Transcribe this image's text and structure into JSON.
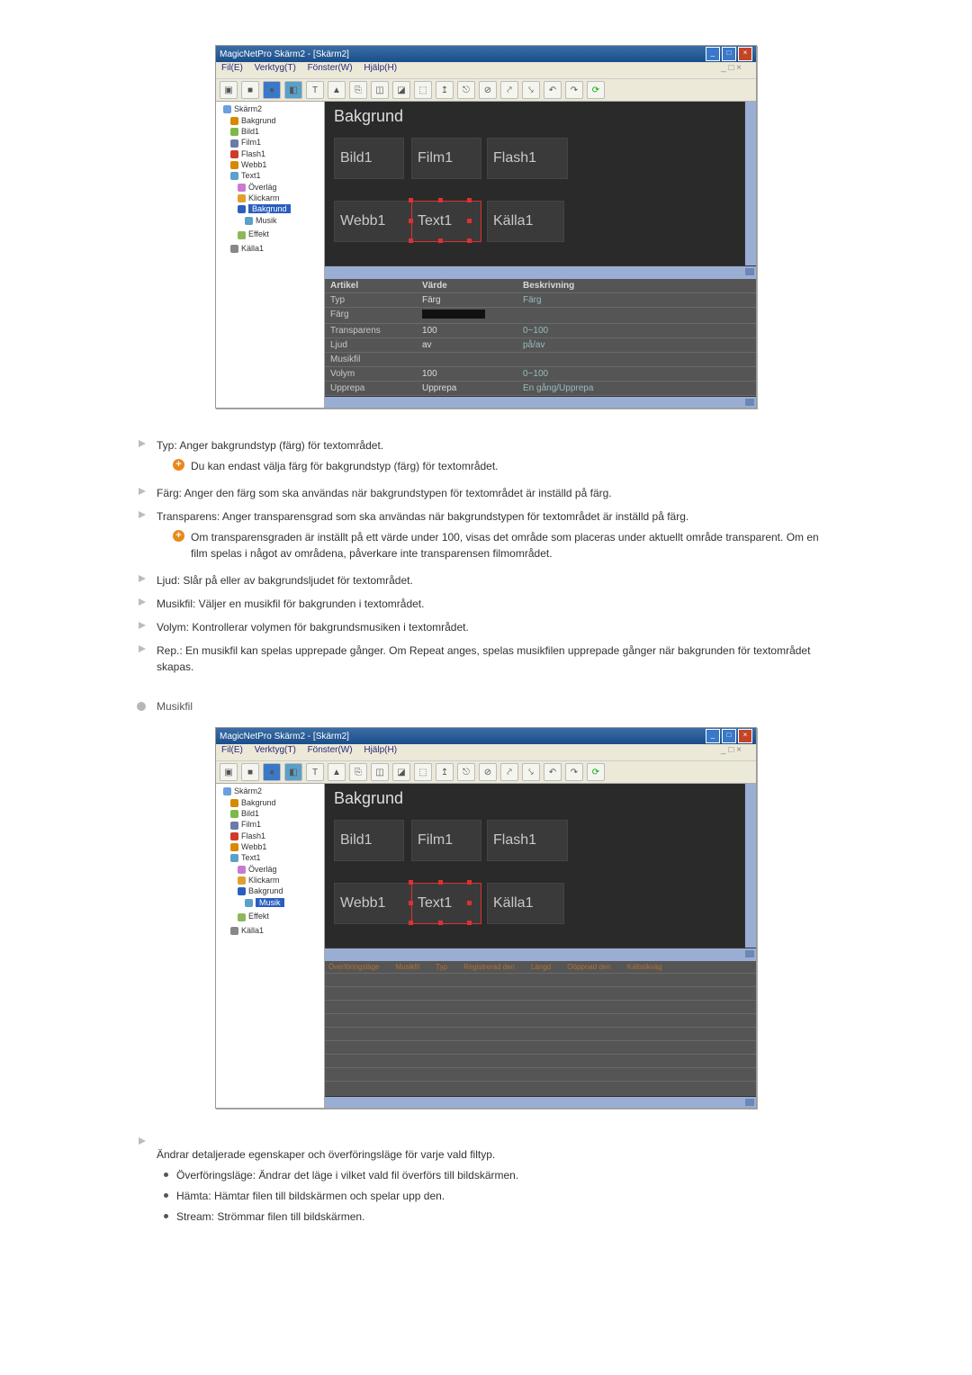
{
  "app": {
    "title": "MagicNetPro Skärm2 - [Skärm2]",
    "menu": [
      "Fil(E)",
      "Verktyg(T)",
      "Fönster(W)",
      "Hjälp(H)"
    ],
    "mdi": "_ □ ×"
  },
  "tree": {
    "root": "Skärm2",
    "items": [
      "Bakgrund",
      "Bild1",
      "Film1",
      "Flash1",
      "Webb1",
      "Text1",
      "Överläg",
      "Klickarm"
    ],
    "sel1": "Bakgrund",
    "sel1b": "Musik",
    "sel2": "Musik",
    "extra": [
      "Effekt",
      "Källa1"
    ]
  },
  "canvas": {
    "title": "Bakgrund",
    "blocks": {
      "b1": "Bild1",
      "b2": "Film1",
      "b3": "Flash1",
      "b4": "Webb1",
      "b5": "Text1",
      "b6": "Källa1"
    }
  },
  "props1": {
    "head": {
      "c1": "Artikel",
      "c2": "Värde",
      "c3": "Beskrivning"
    },
    "rows": [
      {
        "c1": "Typ",
        "c2": "Färg",
        "c3": "Färg"
      },
      {
        "c1": "Färg",
        "c2": "",
        "c3": ""
      },
      {
        "c1": "Transparens",
        "c2": "100",
        "c3": "0~100"
      },
      {
        "c1": "Ljud",
        "c2": "av",
        "c3": "på/av"
      },
      {
        "c1": "Musikfil",
        "c2": "",
        "c3": ""
      },
      {
        "c1": "Volym",
        "c2": "100",
        "c3": "0~100"
      },
      {
        "c1": "Upprepa",
        "c2": "Upprepa",
        "c3": "En gång/Upprepa"
      }
    ]
  },
  "props2": {
    "cols": [
      "Överföringsläge",
      "Musikfil",
      "Typ",
      "Registrerad den",
      "Längd",
      "Oöppnad den",
      "Källsökväg"
    ]
  },
  "doc": {
    "i1": "Typ: Anger bakgrundstyp (färg) för textområdet.",
    "i1a": "Du kan endast välja färg för bakgrundstyp (färg) för textområdet.",
    "i2": "Färg: Anger den färg som ska användas när bakgrundstypen för textområdet är inställd på färg.",
    "i3": "Transparens: Anger transparensgrad som ska användas när bakgrundstypen för textområdet är inställd på färg.",
    "i3a": "Om transparensgraden är inställt på ett värde under 100, visas det område som placeras under aktuellt område transparent. Om en film spelas i något av områdena, påverkare inte transparensen filmområdet.",
    "i4": "Ljud: Slår på eller av bakgrundsljudet för textområdet.",
    "i5": "Musikfil: Väljer en musikfil för bakgrunden i textområdet.",
    "i6": "Volym: Kontrollerar volymen för bakgrundsmusiken i textområdet.",
    "i7": "Rep.: En musikfil kan spelas upprepade gånger. Om Repeat anges, spelas musikfilen upprepade gånger när bakgrunden för textområdet skapas.",
    "sec": "Musikfil",
    "tail": "Ändrar detaljerade egenskaper och överföringsläge för varje vald filtyp.",
    "s1": "Överföringsläge: Ändrar det läge i vilket vald fil överförs till bildskärmen.",
    "s2": "Hämta: Hämtar filen till bildskärmen och spelar upp den.",
    "s3": "Stream: Strömmar filen till bildskärmen."
  }
}
